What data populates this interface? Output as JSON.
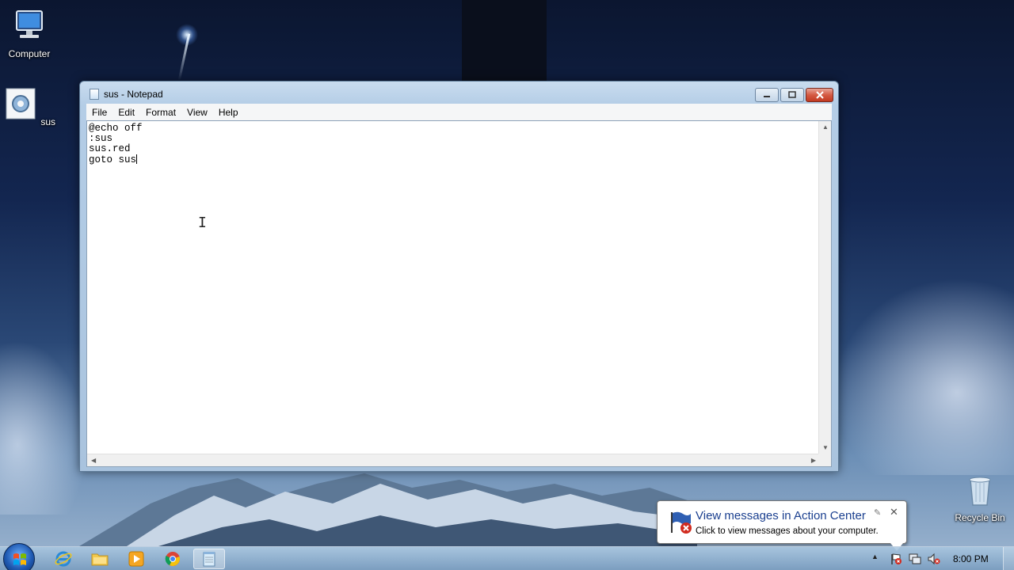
{
  "desktop": {
    "icons": [
      {
        "label": "Computer"
      },
      {
        "label": "sus"
      },
      {
        "label": "Recycle Bin"
      }
    ]
  },
  "notepad": {
    "title": "sus - Notepad",
    "menu": [
      "File",
      "Edit",
      "Format",
      "View",
      "Help"
    ],
    "content": "@echo off\n:sus\nsus.red\ngoto sus"
  },
  "balloon": {
    "title": "View messages in Action Center",
    "body": "Click to view messages about your computer."
  },
  "taskbar": {
    "pinned": [
      {
        "icon": "internet-explorer-icon"
      },
      {
        "icon": "file-explorer-icon"
      },
      {
        "icon": "media-player-icon"
      },
      {
        "icon": "chrome-icon"
      },
      {
        "icon": "notepad-icon",
        "active": true
      }
    ],
    "clock": "8:00 PM"
  },
  "colors": {
    "balloon_title": "#1a3f8f",
    "close_button": "#c23a22"
  }
}
